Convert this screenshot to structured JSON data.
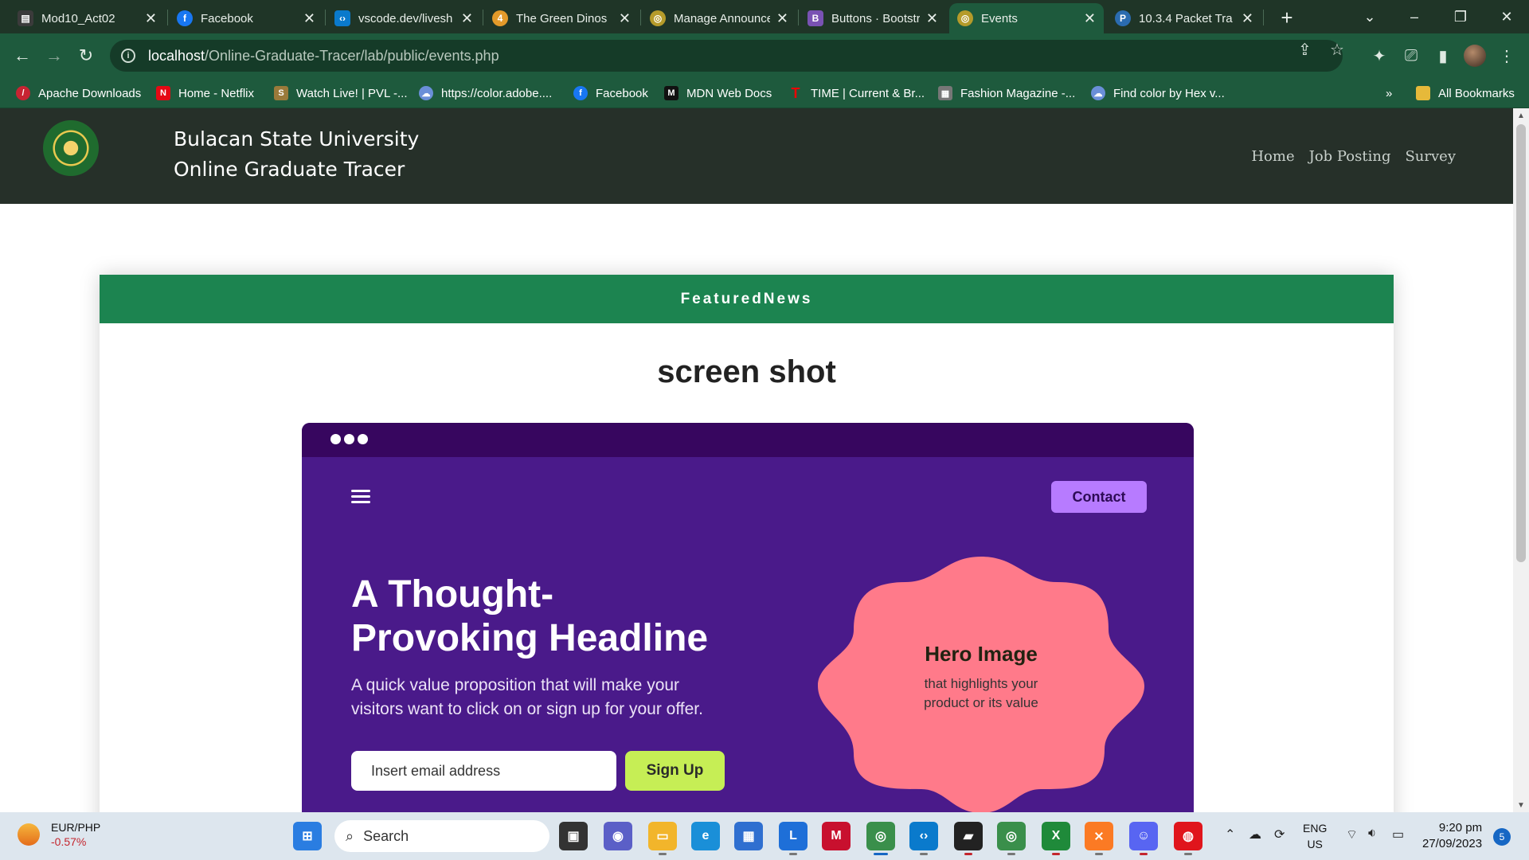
{
  "browser": {
    "tabs": [
      {
        "title": "Mod10_Act02",
        "icon": "document-icon",
        "color": "#3b3b3b",
        "glyph": ""
      },
      {
        "title": "Facebook",
        "icon": "facebook-icon",
        "color": "#1877f2",
        "glyph": "f"
      },
      {
        "title": "vscode.dev/livesh",
        "icon": "vscode-icon",
        "color": "#0a7acc",
        "glyph": "‹›"
      },
      {
        "title": "The Green Dinos",
        "icon": "dino-icon",
        "color": "#e39a2a",
        "glyph": "4"
      },
      {
        "title": "Manage Announce",
        "icon": "manage-icon",
        "color": "#b59b2a",
        "glyph": "◎"
      },
      {
        "title": "Buttons · Bootstra",
        "icon": "bootstrap-icon",
        "color": "#7952b3",
        "glyph": "B"
      },
      {
        "title": "Events",
        "icon": "events-icon",
        "color": "#b59b2a",
        "glyph": "◎"
      },
      {
        "title": "10.3.4 Packet Tra",
        "icon": "packet-tracer-icon",
        "color": "#2b6cb0",
        "glyph": "P"
      }
    ],
    "active_tab": "Events",
    "url_host": "localhost",
    "url_path": "/Online-Graduate-Tracer/lab/public/events.php",
    "bookmarks": [
      {
        "label": "Apache Downloads",
        "icon": "apache-feather-icon",
        "color": "#c72432",
        "glyph": "⁄"
      },
      {
        "label": "Home - Netflix",
        "icon": "netflix-icon",
        "color": "#e50914",
        "glyph": "N"
      },
      {
        "label": "Watch Live! | PVL -...",
        "icon": "pvl-icon",
        "color": "#9a7a3a",
        "glyph": "S"
      },
      {
        "label": "https://color.adobe....",
        "icon": "adobe-color-icon",
        "color": "#6a8fd8",
        "glyph": "☁"
      },
      {
        "label": "Facebook",
        "icon": "facebook-icon",
        "color": "#1877f2",
        "glyph": "f"
      },
      {
        "label": "MDN Web Docs",
        "icon": "mdn-icon",
        "color": "#111111",
        "glyph": "M"
      },
      {
        "label": "TIME | Current & Br...",
        "icon": "time-icon",
        "color": "#e90606",
        "glyph": "T"
      },
      {
        "label": "Fashion Magazine -...",
        "icon": "fashion-icon",
        "color": "#777777",
        "glyph": "▦"
      },
      {
        "label": "Find color by Hex v...",
        "icon": "color-hex-icon",
        "color": "#6a8fd8",
        "glyph": "☁"
      }
    ],
    "more_bookmarks": "»",
    "all_bookmarks": "All Bookmarks"
  },
  "site": {
    "brand_line1": "Bulacan State University",
    "brand_line2": "Online Graduate Tracer",
    "nav": [
      "Home",
      "Job Posting",
      "Survey"
    ]
  },
  "card": {
    "header": "FeaturedNews",
    "title": "screen shot"
  },
  "image": {
    "contact": "Contact",
    "headline_line1": "A Thought-",
    "headline_line2": "Provoking Headline",
    "subtext_line1": "A quick value proposition that will make your",
    "subtext_line2": "visitors want to click on or sign up for your offer.",
    "email_placeholder": "Insert email address",
    "signup": "Sign Up",
    "hero_title": "Hero Image",
    "hero_sub_line1": "that highlights your",
    "hero_sub_line2": "product or its value"
  },
  "taskbar": {
    "ticker_name": "EUR/PHP",
    "ticker_change": "-0.57%",
    "search": "Search",
    "lang_line1": "ENG",
    "lang_line2": "US",
    "time": "9:20 pm",
    "date": "27/09/2023",
    "notifications": "5"
  },
  "colors": {
    "chrome": "#1e5a3d",
    "site_header": "#263029",
    "card_header": "#1c8450",
    "mock_bg": "#4a1a8a",
    "blob": "#ff7a8a"
  }
}
